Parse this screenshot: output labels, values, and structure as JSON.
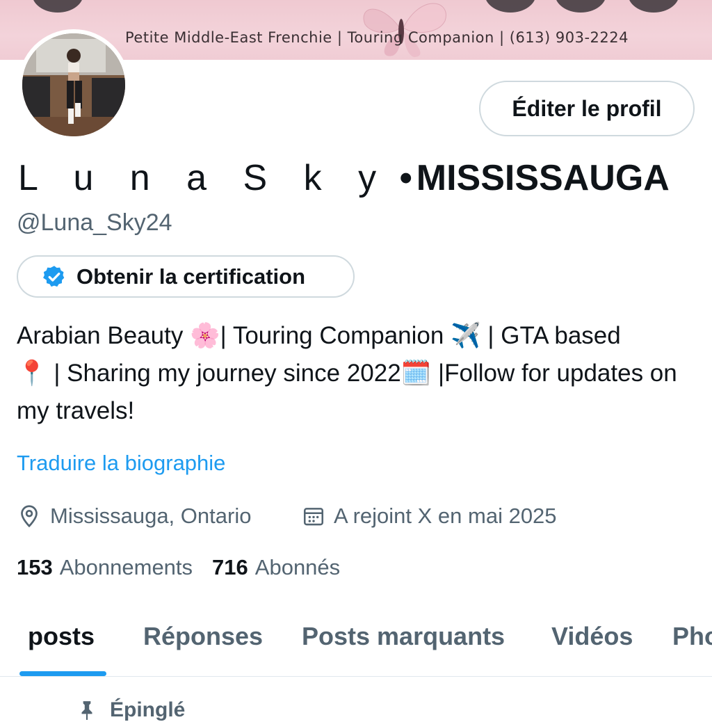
{
  "banner": {
    "text": "Petite Middle-East Frenchie | Touring Companion | (613) 903-2224"
  },
  "profile": {
    "edit_button_label": "Éditer le profil",
    "name_spaced": "L u n a S k y",
    "name_dot": "•",
    "name_city": "MISSISSAUGA",
    "handle": "@Luna_Sky24",
    "certification_label": "Obtenir la certification",
    "bio": {
      "part1": "Arabian Beauty ",
      "emoji1": "🌸",
      "part2": "| Touring Companion ",
      "emoji2": "✈️",
      "part3": " | GTA based",
      "emoji3": "📍",
      "part4": " | Sharing my journey since 2022",
      "emoji4": "🗓️",
      "part5": " |Follow for updates on my travels!"
    },
    "translate_label": "Traduire la biographie",
    "location": "Mississauga, Ontario",
    "joined": "A rejoint X en mai 2025",
    "following_count": "153",
    "following_label": "Abonnements",
    "followers_count": "716",
    "followers_label": "Abonnés"
  },
  "tabs": [
    {
      "label": "posts",
      "active": true
    },
    {
      "label": "Réponses",
      "active": false
    },
    {
      "label": "Posts marquants",
      "active": false
    },
    {
      "label": "Vidéos",
      "active": false
    },
    {
      "label": "Pho",
      "active": false
    }
  ],
  "pinned_label": "Épinglé",
  "colors": {
    "accent": "#1d9bf0",
    "secondary_text": "#536471",
    "banner_pink": "#f0ccd4"
  }
}
